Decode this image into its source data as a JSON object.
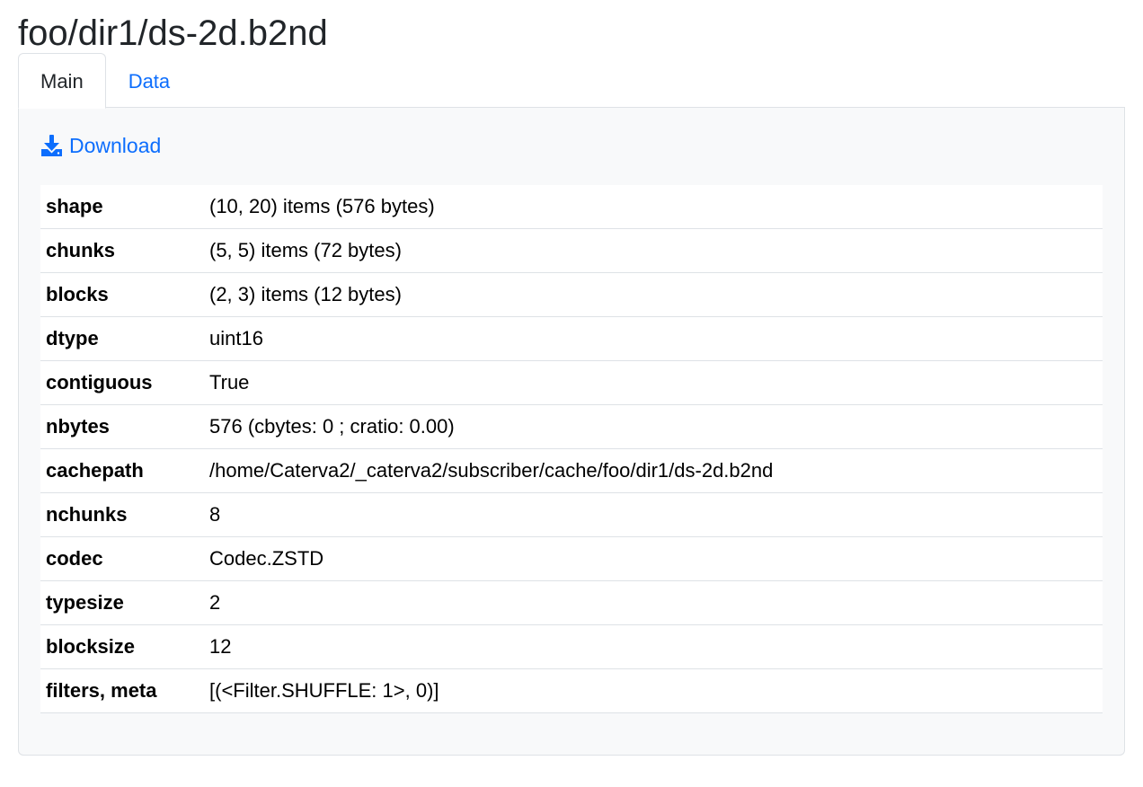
{
  "header": {
    "title": "foo/dir1/ds-2d.b2nd"
  },
  "tabs": [
    {
      "label": "Main",
      "active": true
    },
    {
      "label": "Data",
      "active": false
    }
  ],
  "main": {
    "download_label": "Download",
    "download_icon": "download-icon",
    "rows": [
      {
        "key": "shape",
        "value": "(10, 20) items (576 bytes)"
      },
      {
        "key": "chunks",
        "value": "(5, 5) items (72 bytes)"
      },
      {
        "key": "blocks",
        "value": "(2, 3) items (12 bytes)"
      },
      {
        "key": "dtype",
        "value": "uint16"
      },
      {
        "key": "contiguous",
        "value": "True"
      },
      {
        "key": "nbytes",
        "value": "576 (cbytes: 0 ; cratio: 0.00)"
      },
      {
        "key": "cachepath",
        "value": "/home/Caterva2/_caterva2/subscriber/cache/foo/dir1/ds-2d.b2nd"
      },
      {
        "key": "nchunks",
        "value": "8"
      },
      {
        "key": "codec",
        "value": "Codec.ZSTD"
      },
      {
        "key": "typesize",
        "value": "2"
      },
      {
        "key": "blocksize",
        "value": "12"
      },
      {
        "key": "filters, meta",
        "value": "[(<Filter.SHUFFLE: 1>, 0)]"
      }
    ]
  },
  "colors": {
    "link": "#0d6efd",
    "panel_bg": "#f8f9fa",
    "border": "#dee2e6"
  }
}
